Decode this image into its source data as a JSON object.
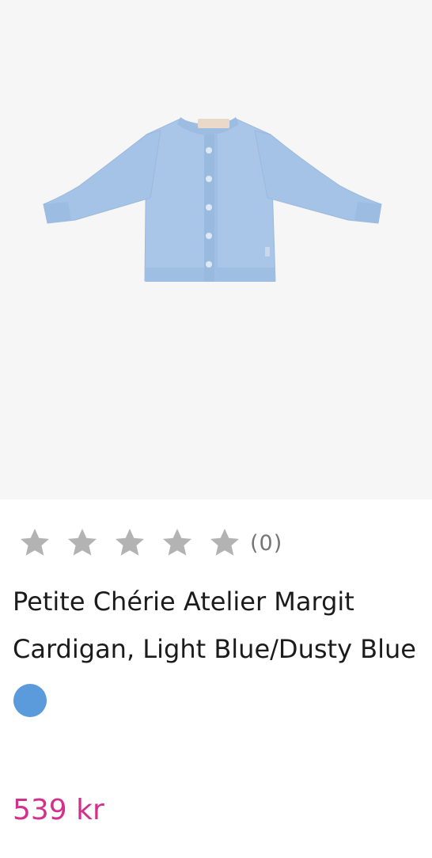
{
  "product": {
    "image": {
      "name": "light-blue-knit-cardigan",
      "background": "#f6f6f7",
      "color": "#a9c6e8"
    },
    "rating": {
      "stars": 5,
      "filled": 0,
      "count_label": "(0)",
      "star_color": "#b3b3b3"
    },
    "title": "Petite Chérie Atelier Margit Cardigan, Light Blue/Dusty Blue",
    "color_swatch": {
      "color": "#5b9bdb"
    },
    "price": "539 kr",
    "price_color": "#d1318a"
  }
}
